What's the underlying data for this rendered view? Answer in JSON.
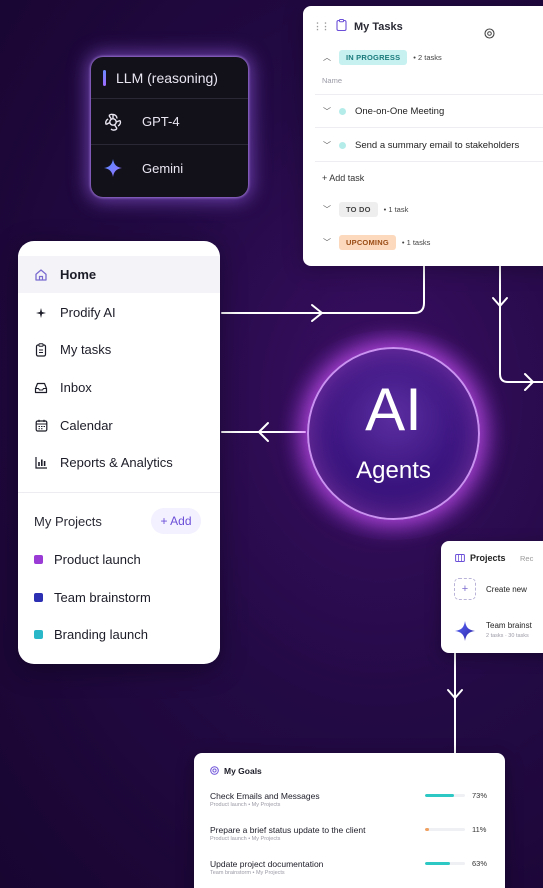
{
  "colors": {
    "background": "#230a45",
    "accent": "#6b4fd8",
    "in_progress": "#c6f1f0",
    "upcoming": "#fcd8bc",
    "teal": "#2ec8c4",
    "orange": "#f0a060"
  },
  "llm_card": {
    "title": "LLM (reasoning)",
    "models": [
      {
        "name": "GPT-4",
        "icon": "openai-icon"
      },
      {
        "name": "Gemini",
        "icon": "gemini-sparkle-icon"
      }
    ]
  },
  "tasks_card": {
    "title": "My Tasks",
    "in_progress": {
      "label": "IN PROGRESS",
      "count": "2 tasks"
    },
    "column_name": "Name",
    "tasks": [
      "One-on-One Meeting",
      "Send a summary email to stakeholders"
    ],
    "add_task": "+ Add task",
    "todo": {
      "label": "TO DO",
      "count": "1 task"
    },
    "upcoming": {
      "label": "UPCOMING",
      "count": "1 tasks"
    }
  },
  "sidebar": {
    "items": [
      {
        "label": "Home",
        "icon": "home-icon"
      },
      {
        "label": "Prodify AI",
        "icon": "sparkle-icon"
      },
      {
        "label": "My tasks",
        "icon": "clipboard-icon"
      },
      {
        "label": "Inbox",
        "icon": "inbox-icon"
      },
      {
        "label": "Calendar",
        "icon": "calendar-icon"
      },
      {
        "label": "Reports & Analytics",
        "icon": "bar-chart-icon"
      }
    ],
    "projects_heading": "My Projects",
    "add_label": "+ Add",
    "projects": [
      {
        "label": "Product launch",
        "color": "#9a3bd6"
      },
      {
        "label": "Team brainstorm",
        "color": "#2d2fb3"
      },
      {
        "label": "Branding launch",
        "color": "#2ab8c9"
      }
    ]
  },
  "orb": {
    "title": "AI",
    "subtitle": "Agents"
  },
  "projects_card": {
    "title": "Projects",
    "tab_cut": "Rec",
    "create": "Create new",
    "item_title": "Team brainst",
    "item_meta": "2 tasks · 30 tasks"
  },
  "goals_card": {
    "title": "My Goals",
    "goals": [
      {
        "name": "Check Emails and Messages",
        "sub": "Product launch  •  My Projects",
        "percent": "73%",
        "progress": 0.73,
        "color": "#2ec8c4"
      },
      {
        "name": "Prepare a brief status update to the client",
        "sub": "Product launch  •  My Projects",
        "percent": "11%",
        "progress": 0.11,
        "color": "#f0a060"
      },
      {
        "name": "Update project documentation",
        "sub": "Team brainstorm  •  My Projects",
        "percent": "63%",
        "progress": 0.63,
        "color": "#2ec8c4"
      }
    ]
  }
}
